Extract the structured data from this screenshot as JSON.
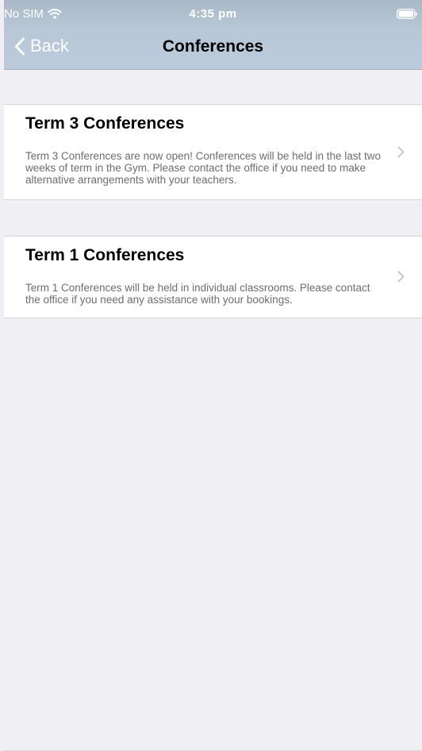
{
  "status_bar": {
    "carrier": "No SIM",
    "time": "4:35 pm",
    "wifi_icon": "wifi-icon",
    "battery_icon": "battery-icon"
  },
  "nav": {
    "back_label": "Back",
    "title": "Conferences",
    "back_icon": "chevron-left-icon"
  },
  "conferences": [
    {
      "title": "Term 3 Conferences",
      "description": "Term 3 Conferences are now open! Conferences will be held in the last two weeks of term in the Gym. Please contact the office if you need to make alternative arrangements with your teachers.",
      "icon": "chevron-right-icon"
    },
    {
      "title": "Term 1 Conferences",
      "description": "Term 1 Conferences will be held in individual classrooms. Please contact the office if you need any assistance with your bookings.",
      "icon": "chevron-right-icon"
    }
  ],
  "colors": {
    "header_bg": "#b7c7d6",
    "page_bg": "#efeff4",
    "card_bg": "#ffffff",
    "secondary_text": "#6d6d72",
    "chevron": "#c7c7cc"
  }
}
